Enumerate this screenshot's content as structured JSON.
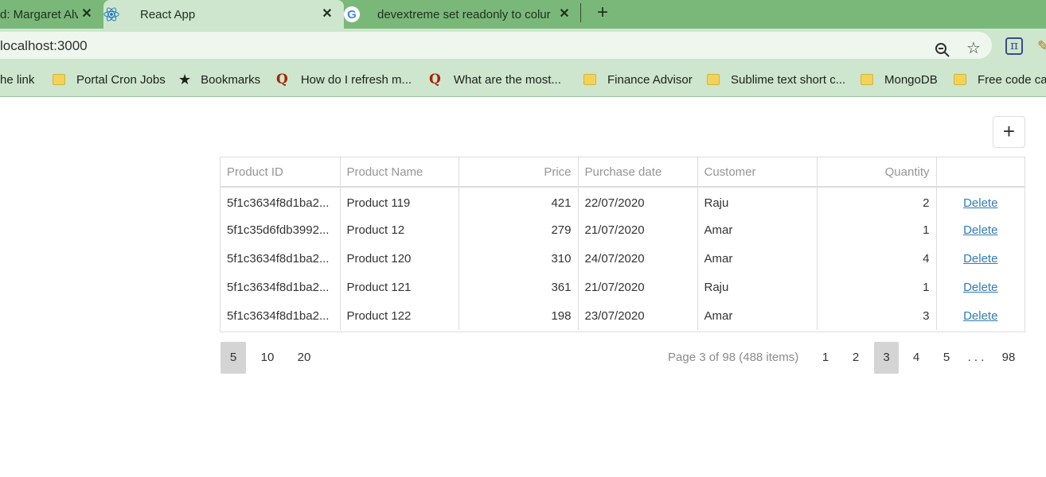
{
  "browser": {
    "tabs": [
      {
        "title": "d: Margaret Alv"
      },
      {
        "title": "React App"
      },
      {
        "title": "devextreme set readonly to colur"
      }
    ],
    "new_tab": "+",
    "close": "✕",
    "url": "localhost:3000",
    "bookmarks": [
      {
        "label": "he link",
        "icon": "none"
      },
      {
        "label": "Portal Cron Jobs",
        "icon": "folder-icon"
      },
      {
        "label": "Bookmarks",
        "icon": "star-icon"
      },
      {
        "label": "How do I refresh m...",
        "icon": "quora-icon"
      },
      {
        "label": "What are the most...",
        "icon": "quora-icon"
      },
      {
        "label": "Finance Advisor",
        "icon": "folder-icon"
      },
      {
        "label": "Sublime text short c...",
        "icon": "folder-icon"
      },
      {
        "label": "MongoDB",
        "icon": "folder-icon"
      },
      {
        "label": "Free code camp",
        "icon": "folder-icon"
      }
    ]
  },
  "toolbar": {
    "add_label": "+"
  },
  "grid": {
    "columns": [
      "Product ID",
      "Product Name",
      "Price",
      "Purchase date",
      "Customer",
      "Quantity",
      ""
    ],
    "rows": [
      {
        "id": "5f1c3634f8d1ba2...",
        "name": "Product 119",
        "price": "421",
        "date": "22/07/2020",
        "customer": "Raju",
        "qty": "2",
        "action": "Delete"
      },
      {
        "id": "5f1c35d6fdb3992...",
        "name": "Product 12",
        "price": "279",
        "date": "21/07/2020",
        "customer": "Amar",
        "qty": "1",
        "action": "Delete"
      },
      {
        "id": "5f1c3634f8d1ba2...",
        "name": "Product 120",
        "price": "310",
        "date": "24/07/2020",
        "customer": "Amar",
        "qty": "4",
        "action": "Delete"
      },
      {
        "id": "5f1c3634f8d1ba2...",
        "name": "Product 121",
        "price": "361",
        "date": "21/07/2020",
        "customer": "Raju",
        "qty": "1",
        "action": "Delete"
      },
      {
        "id": "5f1c3634f8d1ba2...",
        "name": "Product 122",
        "price": "198",
        "date": "23/07/2020",
        "customer": "Amar",
        "qty": "3",
        "action": "Delete"
      }
    ]
  },
  "pager": {
    "page_sizes": [
      "5",
      "10",
      "20"
    ],
    "selected_size": "5",
    "info": "Page 3 of 98 (488 items)",
    "pages": [
      "1",
      "2",
      "3",
      "4",
      "5",
      ". . .",
      "98"
    ],
    "current_page": "3"
  },
  "colors": {
    "tabbar": "#7ab87a",
    "toolbar": "#cde6cd",
    "link": "#337ab7",
    "selected": "#d4d4d4"
  }
}
